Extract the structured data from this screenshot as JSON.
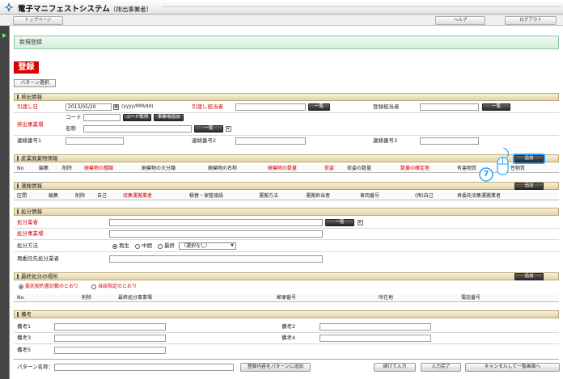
{
  "app": {
    "title": "電子マニフェストシステム",
    "subtitle": "（排出事業者）"
  },
  "nav": {
    "top": "トップページ",
    "help": "ヘルプ",
    "logout": "ログアウト"
  },
  "page": {
    "title": "新規登録",
    "heading": "登録",
    "tab_pattern": "パターン選択"
  },
  "discharge": {
    "section": "排出情報",
    "handover_date_label": "引渡し日",
    "handover_date_value": "2013/05/20",
    "date_format": "(yyyy/MM/dd)",
    "handover_person_label": "引渡し担当者",
    "list_btn": "一覧",
    "register_person_label": "登録担当者",
    "site_label": "排出事業場",
    "code_label": "コード",
    "code_btn": "コード取得",
    "site_add_btn": "事業場追加",
    "name_label": "名称",
    "contact1": "連絡番号1",
    "contact2": "連絡番号2",
    "contact3": "連絡番号3"
  },
  "waste": {
    "section": "産業廃棄物情報",
    "add_btn": "追加",
    "cols": [
      "No.",
      "編集",
      "削除",
      "廃棄物の種類",
      "廃棄物の大分類",
      "廃棄物の名称",
      "廃棄物の数量",
      "荷姿",
      "荷姿の数量",
      "数量の確定者",
      "有害物質",
      "性物質"
    ]
  },
  "transport": {
    "section": "運搬情報",
    "add_btn": "追加",
    "cols": [
      "区間",
      "編集",
      "削除",
      "自己",
      "収集運搬業者",
      "積替・保管施設",
      "運搬方法",
      "運搬担当者",
      "車両番号",
      "(再)自己",
      "再委託収集運搬業者"
    ]
  },
  "disposal": {
    "section": "処分情報",
    "company_label": "処分業者",
    "list_btn": "一覧",
    "site_label": "処分事業場",
    "method_label": "処分方法",
    "options": [
      "再生",
      "中間",
      "最終"
    ],
    "select_value": "（選択なし）",
    "subcontract_label": "再委託先処分業者"
  },
  "final": {
    "section": "最終処分の場所",
    "add_btn": "追加",
    "radio1": "委託契約書記載のとおり",
    "radio2": "当該指定のとおり",
    "cols": [
      "No.",
      "削除",
      "最終処分事業場",
      "郵便番号",
      "所在地",
      "電話番号"
    ]
  },
  "remarks": {
    "section": "備考",
    "labels": [
      "備考1",
      "備考2",
      "備考3",
      "備考4",
      "備考5"
    ]
  },
  "footer": {
    "pattern_label": "パターン名称：",
    "save_pattern_btn": "登録内容をパターンに追加",
    "continue_btn": "続けて入力",
    "complete_btn": "入力完了",
    "cancel_btn": "キャンセルして一覧画面へ"
  },
  "annotation": {
    "step": "7"
  },
  "colors": {
    "accent_red": "#d00000",
    "section_bg": "#e8dcb4",
    "page_bar": "#dff2e4",
    "highlight": "#2aa3ff"
  }
}
